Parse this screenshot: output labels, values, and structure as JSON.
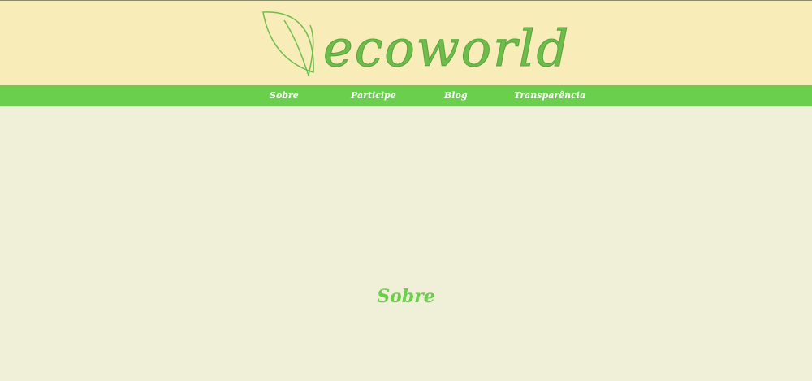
{
  "header": {
    "logo_text": "ecoworld",
    "logo_icon": "leaf-icon"
  },
  "nav": {
    "items": [
      {
        "label": "Sobre"
      },
      {
        "label": "Participe"
      },
      {
        "label": "Blog"
      },
      {
        "label": "Transparência"
      }
    ]
  },
  "main": {
    "section_title": "Sobre"
  },
  "colors": {
    "header_bg": "#f8ecb9",
    "nav_bg": "#6acf4c",
    "page_bg": "#f0efd7",
    "accent": "#6acf4c"
  }
}
